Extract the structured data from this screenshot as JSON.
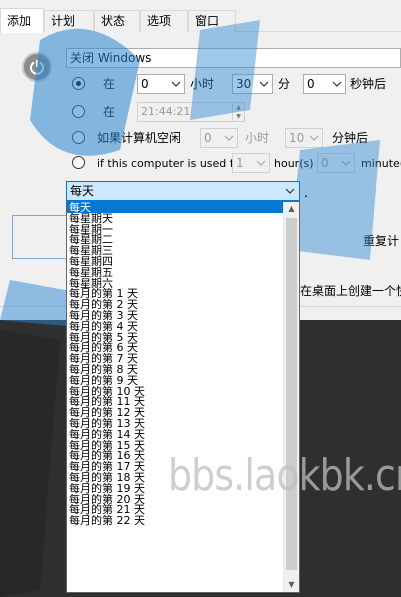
{
  "tabs": [
    {
      "label": "添加",
      "active": true
    },
    {
      "label": "计划",
      "active": false
    },
    {
      "label": "状态",
      "active": false
    },
    {
      "label": "选项",
      "active": false
    },
    {
      "label": "窗口",
      "active": false
    }
  ],
  "action_select": {
    "value": "关闭 Windows"
  },
  "row1": {
    "prefix": "在",
    "hours": "0",
    "hours_unit": "小时",
    "minutes": "30",
    "minutes_unit": "分",
    "seconds": "0",
    "seconds_unit": "秒钟后"
  },
  "row2": {
    "prefix": "在",
    "time": "21:44:21"
  },
  "row3": {
    "prefix": "如果计算机空闲",
    "hours": "0",
    "hours_unit": "小时",
    "minutes": "10",
    "minutes_unit": "分钟后"
  },
  "row4": {
    "prefix": "if this computer is used for",
    "hours": "1",
    "hours_unit": "hour(s)",
    "minutes": "0",
    "minutes_unit": "minute(s"
  },
  "repeat_label": "重复计",
  "shortcut_label": "在桌面上创建一个快",
  "combo": {
    "value": "每天",
    "suffix": "."
  },
  "dropdown_items": [
    "每天",
    "每星期天",
    "每星期一",
    "每星期二",
    "每星期三",
    "每星期四",
    "每星期五",
    "每星期六",
    "每月的第 1 天",
    "每月的第 2 天",
    "每月的第 3 天",
    "每月的第 4 天",
    "每月的第 5 天",
    "每月的第 6 天",
    "每月的第 7 天",
    "每月的第 8 天",
    "每月的第 9 天",
    "每月的第 10 天",
    "每月的第 11 天",
    "每月的第 12 天",
    "每月的第 13 天",
    "每月的第 14 天",
    "每月的第 15 天",
    "每月的第 16 天",
    "每月的第 17 天",
    "每月的第 18 天",
    "每月的第 19 天",
    "每月的第 20 天",
    "每月的第 21 天",
    "每月的第 22 天"
  ],
  "selected_index": 0,
  "watermark": "bbs.laokbk.cn",
  "colors": {
    "accent": "#0078d7",
    "watermark_blue": "#2a86d2"
  }
}
